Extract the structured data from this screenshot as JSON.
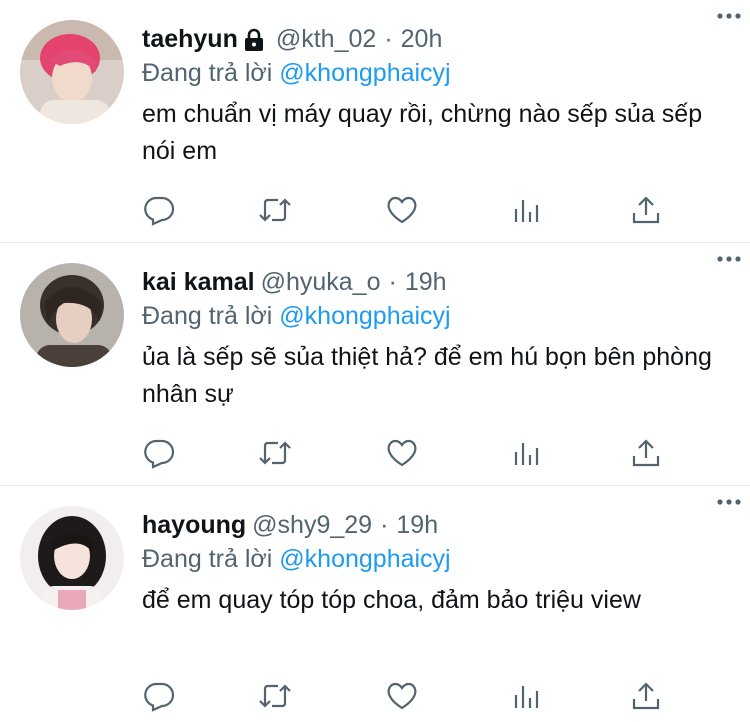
{
  "colors": {
    "accent": "#1d9bf0",
    "secondary_text": "#536471",
    "primary_text": "#0f1419",
    "divider": "#e1e5e8"
  },
  "icons": {
    "lock": "lock-icon",
    "more": "more-icon",
    "reply": "reply-icon",
    "retweet": "retweet-icon",
    "like": "heart-icon",
    "views": "views-icon",
    "share": "share-icon"
  },
  "tweets": [
    {
      "name": "taehyun",
      "protected": true,
      "handle": "@kth_02",
      "separator": "·",
      "time": "20h",
      "replying_prefix": "Đang trả lời",
      "replying_to": "@khongphaicyj",
      "text": "em chuẩn vị máy quay rồi, chừng nào sếp sủa sếp nói em"
    },
    {
      "name": "kai kamal",
      "protected": false,
      "handle": "@hyuka_o",
      "separator": "·",
      "time": "19h",
      "replying_prefix": "Đang trả lời",
      "replying_to": "@khongphaicyj",
      "text": "ủa là sếp sẽ sủa thiệt hả? để em hú bọn bên phòng nhân sự"
    },
    {
      "name": "hayoung",
      "protected": false,
      "handle": "@shy9_29",
      "separator": "·",
      "time": "19h",
      "replying_prefix": "Đang trả lời",
      "replying_to": "@khongphaicyj",
      "text": "để em quay tóp tóp choa, đảm bảo triệu view"
    }
  ]
}
